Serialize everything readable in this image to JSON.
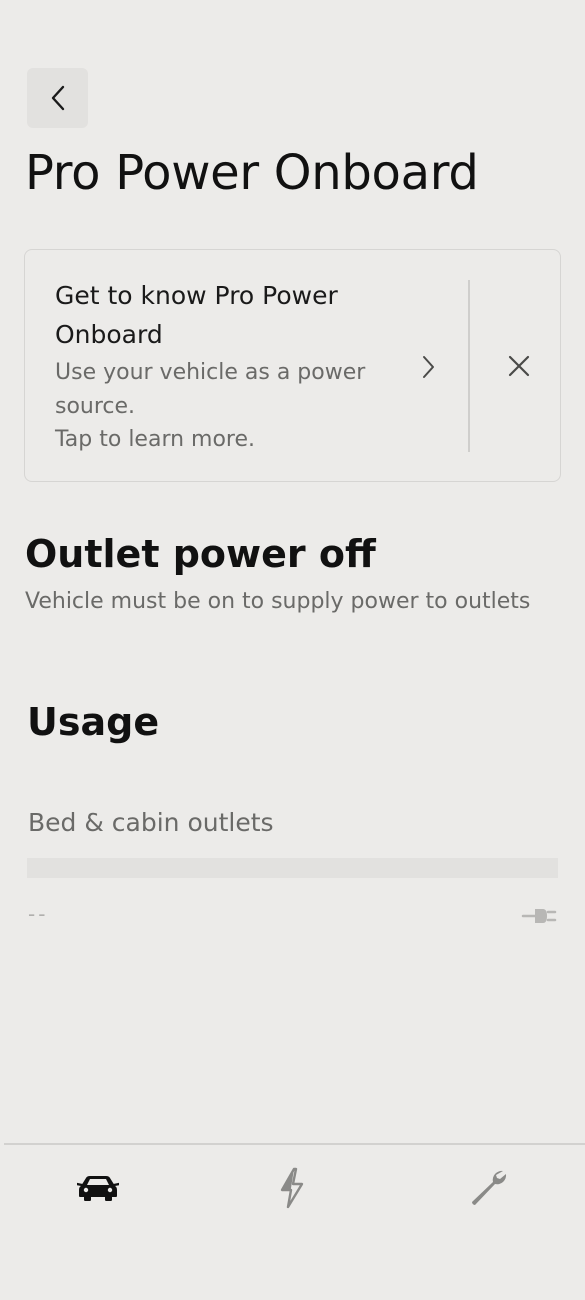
{
  "header": {
    "back_icon": "chevron-left-icon",
    "title": "Pro Power Onboard"
  },
  "info_card": {
    "heading": "Get to know Pro Power Onboard",
    "description_line1": "Use your vehicle as a power source.",
    "description_line2": "Tap to learn more.",
    "chevron_icon": "chevron-right-icon",
    "close_icon": "close-icon"
  },
  "status": {
    "title": "Outlet power off",
    "description": "Vehicle must be on to supply power to outlets"
  },
  "usage": {
    "title": "Usage",
    "outlet_label": "Bed & cabin outlets",
    "progress": 0,
    "value": "--",
    "plug_icon": "plug-icon"
  },
  "bottom_nav": {
    "tabs": [
      {
        "icon": "car-icon",
        "active": true
      },
      {
        "icon": "lightning-icon",
        "active": false
      },
      {
        "icon": "wrench-icon",
        "active": false
      }
    ]
  },
  "colors": {
    "background": "#ecebe9",
    "text_primary": "#111111",
    "text_secondary": "#6a6a68",
    "inactive_icon": "#8a8a88"
  }
}
